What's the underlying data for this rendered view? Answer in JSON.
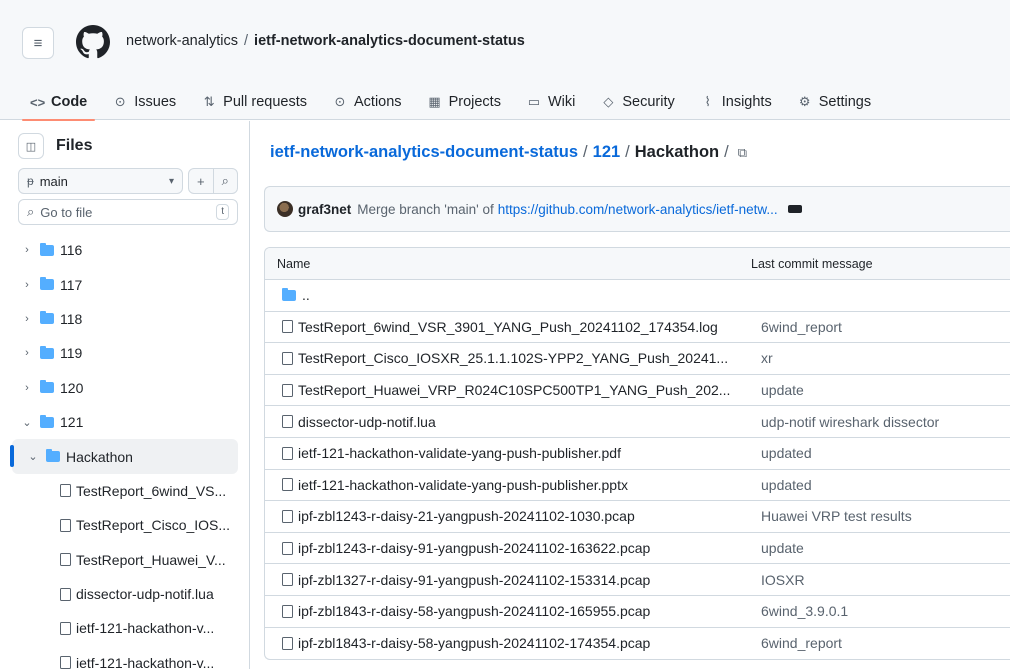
{
  "header": {
    "owner": "network-analytics",
    "separator": "/",
    "repo": "ietf-network-analytics-document-status",
    "menu_icon": "≡"
  },
  "tabs": [
    {
      "label": "Code",
      "icon": "<>",
      "icon_name": "code-icon"
    },
    {
      "label": "Issues",
      "icon": "⊙",
      "icon_name": "issue-icon"
    },
    {
      "label": "Pull requests",
      "icon": "⇅",
      "icon_name": "pull-request-icon"
    },
    {
      "label": "Actions",
      "icon": "⊙",
      "icon_name": "actions-icon"
    },
    {
      "label": "Projects",
      "icon": "▦",
      "icon_name": "projects-icon"
    },
    {
      "label": "Wiki",
      "icon": "▭",
      "icon_name": "wiki-icon"
    },
    {
      "label": "Security",
      "icon": "◇",
      "icon_name": "shield-icon"
    },
    {
      "label": "Insights",
      "icon": "⌇",
      "icon_name": "graph-icon"
    },
    {
      "label": "Settings",
      "icon": "⚙",
      "icon_name": "gear-icon"
    }
  ],
  "sidebar": {
    "title": "Files",
    "branch": "main",
    "add_icon": "+",
    "search_icon": "⌕",
    "go_to_file": "Go to file",
    "go_to_file_kbd": "t",
    "tree": [
      {
        "label": "116",
        "type": "folder",
        "expanded": false,
        "depth": 0
      },
      {
        "label": "117",
        "type": "folder",
        "expanded": false,
        "depth": 0
      },
      {
        "label": "118",
        "type": "folder",
        "expanded": false,
        "depth": 0
      },
      {
        "label": "119",
        "type": "folder",
        "expanded": false,
        "depth": 0
      },
      {
        "label": "120",
        "type": "folder",
        "expanded": false,
        "depth": 0
      },
      {
        "label": "121",
        "type": "folder",
        "expanded": true,
        "depth": 0
      },
      {
        "label": "Hackathon",
        "type": "folder",
        "expanded": true,
        "depth": 1,
        "selected": true
      },
      {
        "label": "TestReport_6wind_VS...",
        "type": "file",
        "depth": 2
      },
      {
        "label": "TestReport_Cisco_IOS...",
        "type": "file",
        "depth": 2
      },
      {
        "label": "TestReport_Huawei_V...",
        "type": "file",
        "depth": 2
      },
      {
        "label": "dissector-udp-notif.lua",
        "type": "file",
        "depth": 2
      },
      {
        "label": "ietf-121-hackathon-v...",
        "type": "file",
        "depth": 2
      },
      {
        "label": "ietf-121-hackathon-v...",
        "type": "file",
        "depth": 2
      }
    ]
  },
  "main": {
    "breadcrumb": {
      "repo": "ietf-network-analytics-document-status",
      "folder": "121",
      "current": "Hackathon",
      "sep": "/"
    },
    "commit": {
      "author": "graf3net",
      "message": "Merge branch 'main' of",
      "link": "https://github.com/network-analytics/ietf-netw..."
    },
    "table": {
      "col_name": "Name",
      "col_commit": "Last commit message",
      "parent": "..",
      "rows": [
        {
          "name": "TestReport_6wind_VSR_3901_YANG_Push_20241102_174354.log",
          "commit": "6wind_report"
        },
        {
          "name": "TestReport_Cisco_IOSXR_25.1.1.102S-YPP2_YANG_Push_20241...",
          "commit": "xr"
        },
        {
          "name": "TestReport_Huawei_VRP_R024C10SPC500TP1_YANG_Push_202...",
          "commit": "update"
        },
        {
          "name": "dissector-udp-notif.lua",
          "commit": "udp-notif wireshark dissector"
        },
        {
          "name": "ietf-121-hackathon-validate-yang-push-publisher.pdf",
          "commit": "updated"
        },
        {
          "name": "ietf-121-hackathon-validate-yang-push-publisher.pptx",
          "commit": "updated"
        },
        {
          "name": "ipf-zbl1243-r-daisy-21-yangpush-20241102-1030.pcap",
          "commit": "Huawei VRP test results"
        },
        {
          "name": "ipf-zbl1243-r-daisy-91-yangpush-20241102-163622.pcap",
          "commit": "update"
        },
        {
          "name": "ipf-zbl1327-r-daisy-91-yangpush-20241102-153314.pcap",
          "commit": "IOSXR"
        },
        {
          "name": "ipf-zbl1843-r-daisy-58-yangpush-20241102-165955.pcap",
          "commit": "6wind_3.9.0.1"
        },
        {
          "name": "ipf-zbl1843-r-daisy-58-yangpush-20241102-174354.pcap",
          "commit": "6wind_report"
        }
      ]
    }
  },
  "colors": {
    "accent": "#0969da",
    "folder": "#54aeff",
    "tab_underline": "#fd8c73",
    "border": "#d1d9e0"
  }
}
